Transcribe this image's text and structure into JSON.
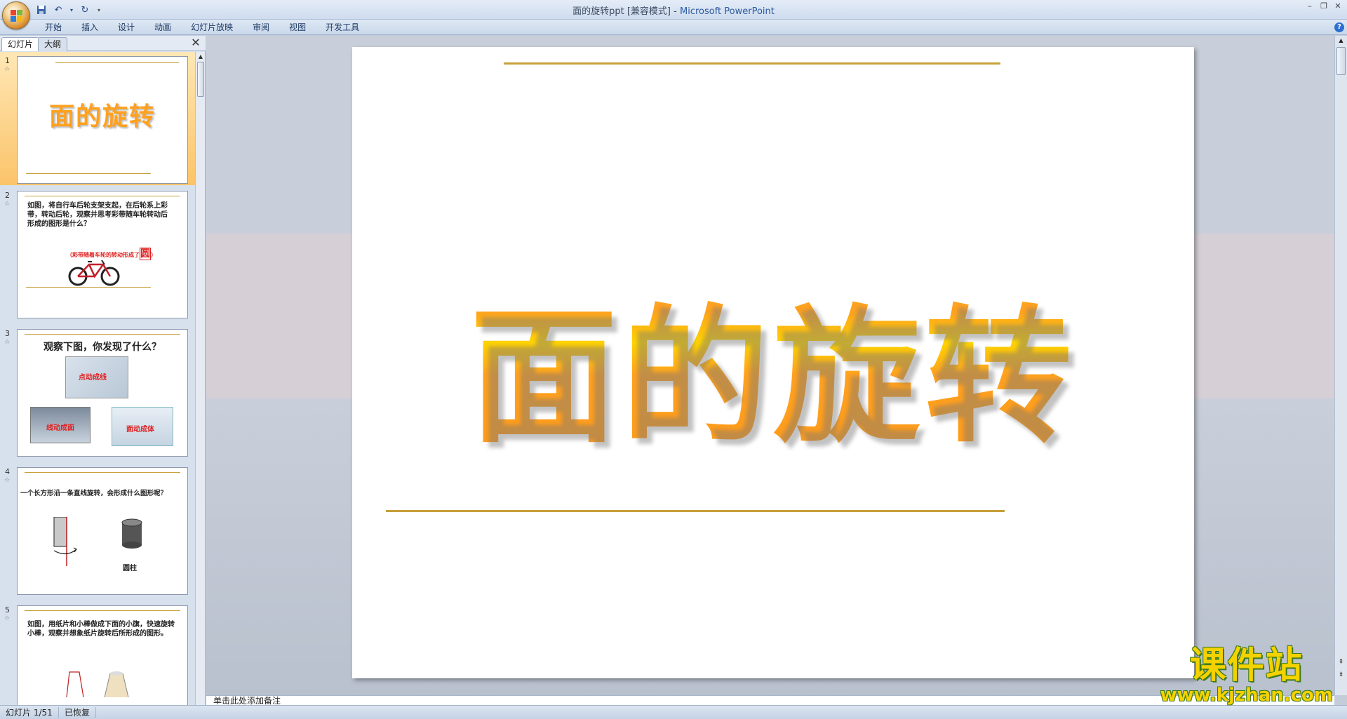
{
  "window": {
    "title_doc": "面的旋转ppt [兼容模式]",
    "title_sep": " - ",
    "title_app": "Microsoft PowerPoint"
  },
  "ribbon": {
    "tabs": [
      "开始",
      "插入",
      "设计",
      "动画",
      "幻灯片放映",
      "审阅",
      "视图",
      "开发工具"
    ]
  },
  "panel": {
    "tab_slides": "幻灯片",
    "tab_outline": "大纲"
  },
  "thumbnails": [
    {
      "num": "1",
      "title": "面的旋转"
    },
    {
      "num": "2",
      "text": "如图，将自行车后轮支架支起，在后轮系上彩带，转动后轮，观察并思考彩带随车轮转动后形成的图形是什么？",
      "caption": "（彩带随着车轮的转动形成了",
      "big_char": "圆",
      "caption_end": "）"
    },
    {
      "num": "3",
      "title": "观察下图，你发现了什么？",
      "img_labels": [
        "点动成线",
        "线动成面",
        "面动成体"
      ]
    },
    {
      "num": "4",
      "text": "一个长方形沿一条直线旋转，会形成什么图形呢？",
      "shape_label": "圆柱"
    },
    {
      "num": "5",
      "text": "如图，用纸片和小棒做成下面的小旗，快速旋转小棒，观察并想象纸片旋转后所形成的图形。"
    }
  ],
  "slide": {
    "title": "面的旋转"
  },
  "notes": {
    "text": "单击此处添加备注"
  },
  "status": {
    "slide_counter": "幻灯片 1/51",
    "recovered": "已恢复"
  },
  "watermark": {
    "cn": "课件站",
    "url": "www.kjzhan.com"
  },
  "colors": {
    "accent_gold": "#c8a03a",
    "title_orange": "#ffa11f",
    "title_yellow": "#ffd400"
  }
}
